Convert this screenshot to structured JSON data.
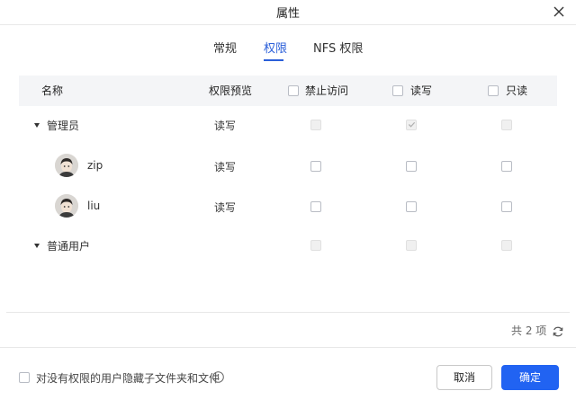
{
  "dialog": {
    "title": "属性"
  },
  "tabs": [
    {
      "label": "常规",
      "active": false
    },
    {
      "label": "权限",
      "active": true
    },
    {
      "label": "NFS 权限",
      "active": false
    }
  ],
  "table": {
    "headers": {
      "name": "名称",
      "preview": "权限预览",
      "deny": "禁止访问",
      "readwrite": "读写",
      "readonly": "只读"
    },
    "rows": [
      {
        "type": "group",
        "name": "管理员",
        "preview": "读写",
        "deny": false,
        "readwrite": true,
        "readonly": false
      },
      {
        "type": "user",
        "name": "zip",
        "preview": "读写",
        "deny": false,
        "readwrite": false,
        "readonly": false
      },
      {
        "type": "user",
        "name": "liu",
        "preview": "读写",
        "deny": false,
        "readwrite": false,
        "readonly": false
      },
      {
        "type": "group",
        "name": "普通用户",
        "preview": "",
        "deny": false,
        "readwrite": false,
        "readonly": false
      }
    ]
  },
  "pagination": {
    "total_text": "共 2 项"
  },
  "footer": {
    "hide_label": "对没有权限的用户隐藏子文件夹和文件",
    "cancel_label": "取消",
    "ok_label": "确定"
  },
  "colors": {
    "accent": "#2163f2",
    "tab_active": "#2b5fd9",
    "header_bg": "#f4f5f7"
  },
  "icons": [
    "close-icon",
    "caret-down-icon",
    "refresh-icon",
    "info-icon",
    "checkmark-icon",
    "user-avatar"
  ]
}
